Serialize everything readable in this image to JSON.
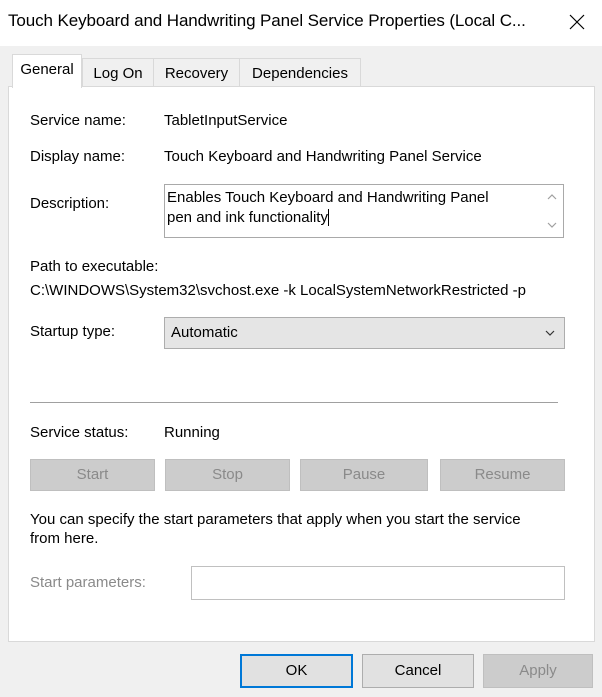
{
  "window": {
    "title": "Touch Keyboard and Handwriting Panel Service Properties (Local C...",
    "close_icon": "close-icon"
  },
  "tabs": [
    {
      "label": "General",
      "active": true
    },
    {
      "label": "Log On",
      "active": false
    },
    {
      "label": "Recovery",
      "active": false
    },
    {
      "label": "Dependencies",
      "active": false
    }
  ],
  "general": {
    "service_name_label": "Service name:",
    "service_name": "TabletInputService",
    "display_name_label": "Display name:",
    "display_name": "Touch Keyboard and Handwriting Panel Service",
    "description_label": "Description:",
    "description_line1": "Enables Touch Keyboard and Handwriting Panel",
    "description_line2": "pen and ink functionality",
    "path_label": "Path to executable:",
    "path": "C:\\WINDOWS\\System32\\svchost.exe -k LocalSystemNetworkRestricted -p",
    "startup_label": "Startup type:",
    "startup_value": "Automatic",
    "status_label": "Service status:",
    "status_value": "Running",
    "buttons": {
      "start": "Start",
      "stop": "Stop",
      "pause": "Pause",
      "resume": "Resume"
    },
    "help_line1": "You can specify the start parameters that apply when you start the service",
    "help_line2": "from here.",
    "start_params_label": "Start parameters:",
    "start_params_value": ""
  },
  "footer": {
    "ok": "OK",
    "cancel": "Cancel",
    "apply": "Apply"
  },
  "colors": {
    "focus_border": "#0078d7",
    "disabled_text": "#8a8a8a"
  }
}
